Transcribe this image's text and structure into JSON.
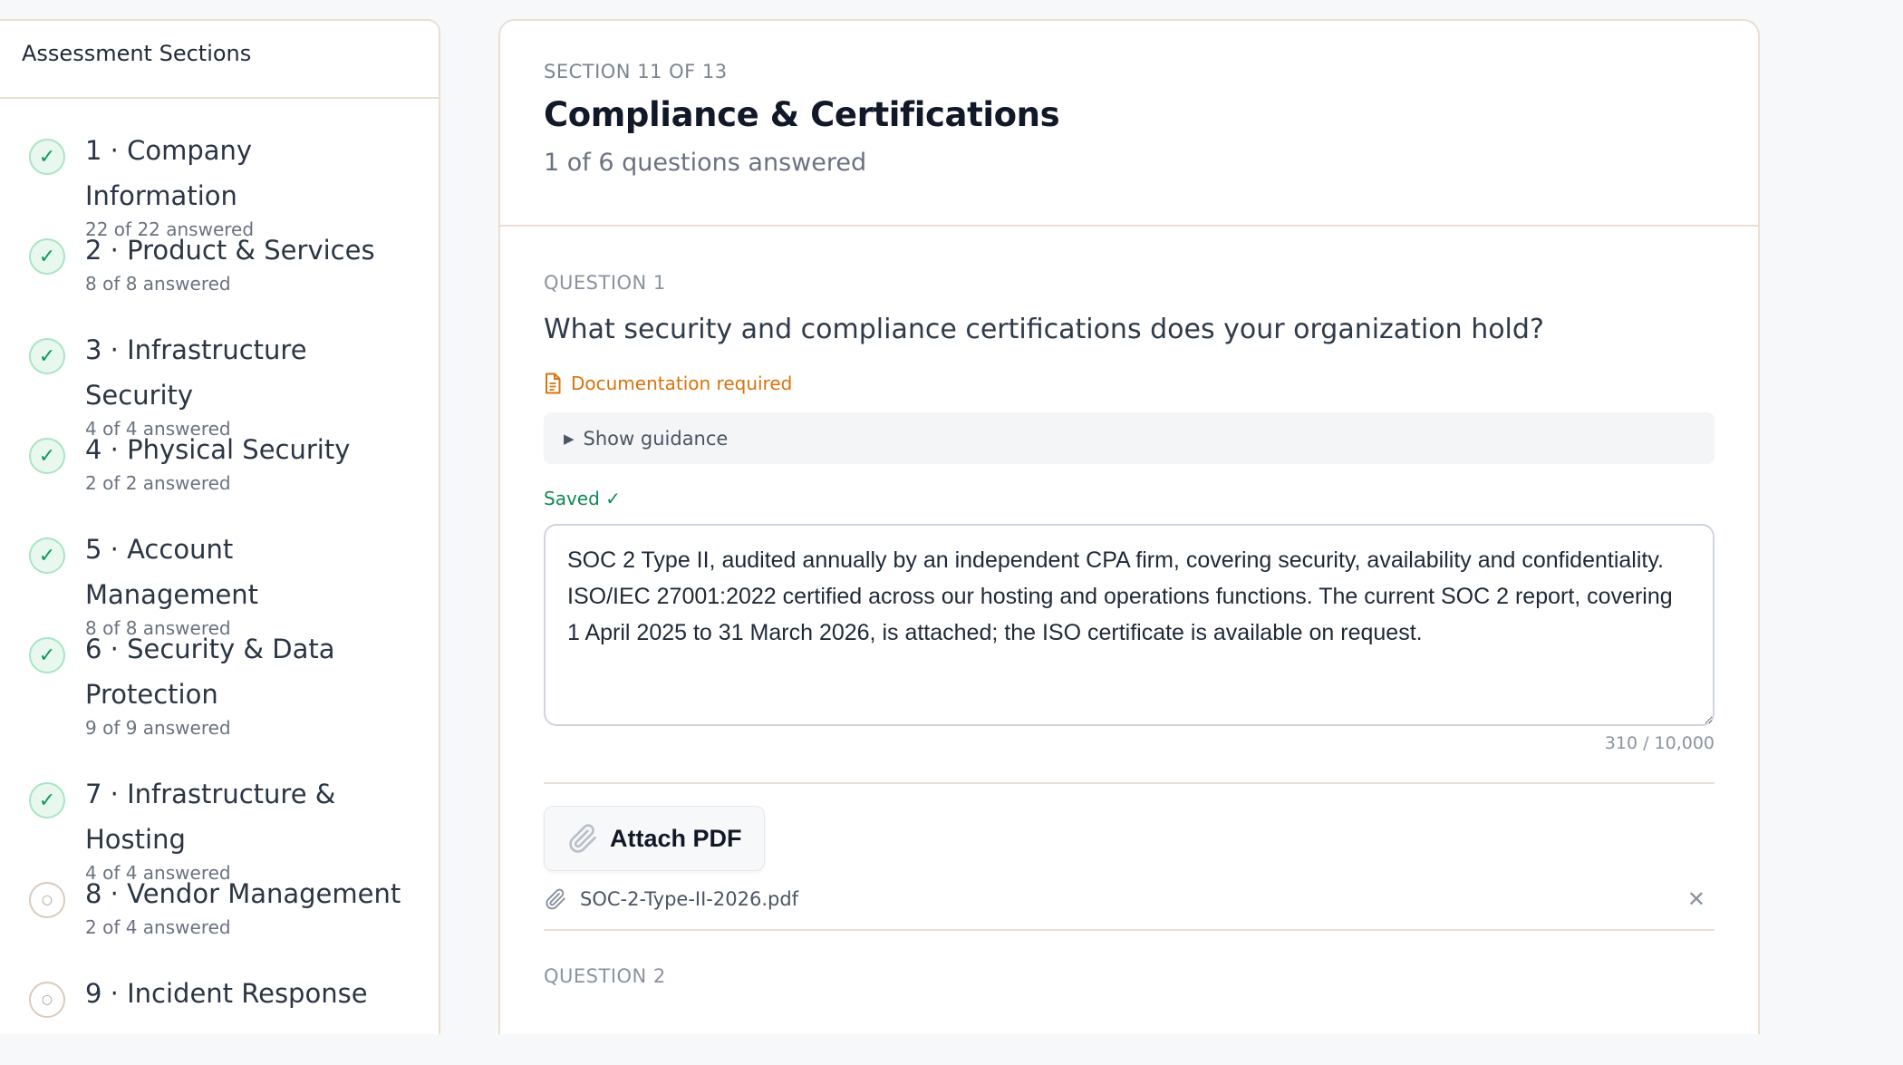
{
  "sidebar": {
    "title": "Assessment Sections",
    "items": [
      {
        "label": "1 · Company Information",
        "sub": "22 of 22 answered",
        "status": "complete"
      },
      {
        "label": "2 · Product & Services",
        "sub": "8 of 8 answered",
        "status": "complete"
      },
      {
        "label": "3 · Infrastructure Security",
        "sub": "4 of 4 answered",
        "status": "complete"
      },
      {
        "label": "4 · Physical Security",
        "sub": "2 of 2 answered",
        "status": "complete"
      },
      {
        "label": "5 · Account Management",
        "sub": "8 of 8 answered",
        "status": "complete"
      },
      {
        "label": "6 · Security & Data Protection",
        "sub": "9 of 9 answered",
        "status": "complete"
      },
      {
        "label": "7 · Infrastructure & Hosting",
        "sub": "4 of 4 answered",
        "status": "complete"
      },
      {
        "label": "8 · Vendor Management",
        "sub": "2 of 4 answered",
        "status": "incomplete"
      },
      {
        "label": "9 · Incident Response",
        "sub": "",
        "status": "incomplete"
      }
    ],
    "status_icons": {
      "complete": "✓",
      "incomplete": "○"
    }
  },
  "section": {
    "label": "SECTION 11 OF 13",
    "title": "Compliance & Certifications",
    "progress": "1 of 6 questions answered"
  },
  "question": {
    "label": "QUESTION 1",
    "text": "What security and compliance certifications does your organization hold?",
    "doc_required": "Documentation required",
    "guidance_label": "Show guidance",
    "saved_status": "Saved ✓",
    "answer": "SOC 2 Type II, audited annually by an independent CPA firm, covering security, availability and confidentiality. ISO/IEC 27001:2022 certified across our hosting and operations functions. The current SOC 2 report, covering 1 April 2025 to 31 March 2026, is attached; the ISO certificate is available on request.",
    "char_count": "310 / 10,000",
    "attach_label": "Attach PDF",
    "attachment": {
      "filename": "SOC-2-Type-II-2026.pdf",
      "remove_glyph": "✕"
    }
  },
  "next_question": {
    "label": "QUESTION 2"
  },
  "colors": {
    "complete": "#0f9a5a",
    "doc_required": "#d9730d",
    "saved": "#0f8a52",
    "border": "#eadfd3"
  }
}
